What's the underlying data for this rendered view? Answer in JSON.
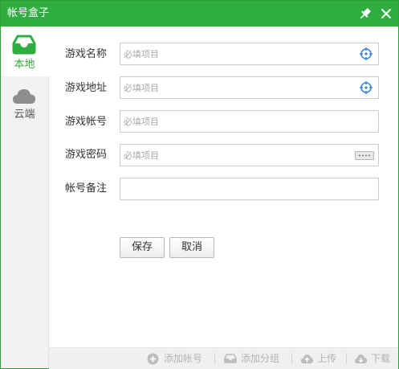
{
  "window": {
    "title": "帐号盒子",
    "accent_color": "#2fad3f"
  },
  "titlebar_buttons": {
    "pin_icon": "pin-icon",
    "close_icon": "close-icon"
  },
  "sidebar": {
    "items": [
      {
        "label": "本地",
        "icon": "inbox-tray-icon",
        "selected": true
      },
      {
        "label": "云端",
        "icon": "cloud-icon",
        "selected": false
      }
    ]
  },
  "form": {
    "fields": [
      {
        "label": "游戏名称",
        "value": "",
        "placeholder": "必填项目",
        "icon": "crosshair-icon"
      },
      {
        "label": "游戏地址",
        "value": "",
        "placeholder": "必填项目",
        "icon": "crosshair-icon"
      },
      {
        "label": "游戏帐号",
        "value": "",
        "placeholder": "必填项目"
      },
      {
        "label": "游戏密码",
        "value": "",
        "placeholder": "必填项目",
        "icon": "password-dots-icon"
      },
      {
        "label": "帐号备注",
        "value": "",
        "placeholder": ""
      }
    ],
    "save_label": "保存",
    "cancel_label": "取消"
  },
  "bottombar": {
    "items": [
      {
        "label": "添加帐号",
        "icon": "plus-circle-icon"
      },
      {
        "label": "添加分组",
        "icon": "inbox-tray-icon"
      },
      {
        "label": "上传",
        "icon": "cloud-upload-icon"
      },
      {
        "label": "下载",
        "icon": "cloud-download-icon"
      }
    ]
  }
}
